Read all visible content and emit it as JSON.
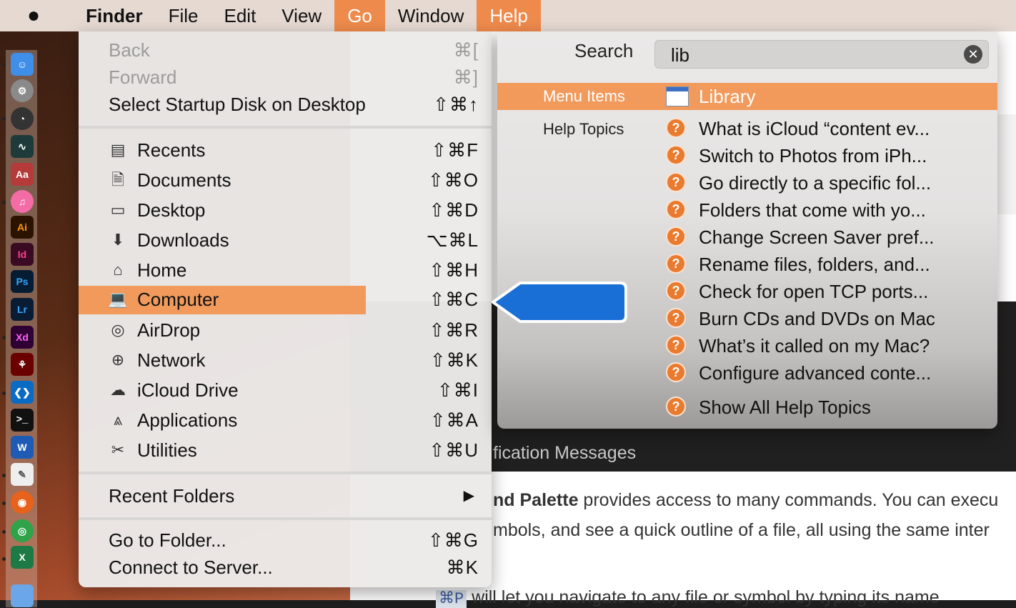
{
  "menubar": {
    "app_name": "Finder",
    "items": [
      "File",
      "Edit",
      "View",
      "Go",
      "Window",
      "Help"
    ],
    "active": [
      "Go",
      "Help"
    ]
  },
  "go_menu": {
    "top_items": [
      {
        "label": "Back",
        "shortcut": "⌘[",
        "disabled": true
      },
      {
        "label": "Forward",
        "shortcut": "⌘]",
        "disabled": true
      },
      {
        "label": "Select Startup Disk on Desktop",
        "shortcut": "⇧⌘↑",
        "disabled": false
      }
    ],
    "places": [
      {
        "label": "Recents",
        "shortcut": "⇧⌘F",
        "icon": "recents-icon"
      },
      {
        "label": "Documents",
        "shortcut": "⇧⌘O",
        "icon": "documents-icon"
      },
      {
        "label": "Desktop",
        "shortcut": "⇧⌘D",
        "icon": "desktop-icon"
      },
      {
        "label": "Downloads",
        "shortcut": "⌥⌘L",
        "icon": "downloads-icon"
      },
      {
        "label": "Home",
        "shortcut": "⇧⌘H",
        "icon": "home-icon"
      },
      {
        "label": "Computer",
        "shortcut": "⇧⌘C",
        "icon": "computer-icon",
        "selected": true
      },
      {
        "label": "AirDrop",
        "shortcut": "⇧⌘R",
        "icon": "airdrop-icon"
      },
      {
        "label": "Network",
        "shortcut": "⇧⌘K",
        "icon": "network-icon"
      },
      {
        "label": "iCloud Drive",
        "shortcut": "⇧⌘I",
        "icon": "icloud-icon"
      },
      {
        "label": "Applications",
        "shortcut": "⇧⌘A",
        "icon": "applications-icon"
      },
      {
        "label": "Utilities",
        "shortcut": "⇧⌘U",
        "icon": "utilities-icon"
      }
    ],
    "recent_folders": "Recent Folders",
    "bottom_items": [
      {
        "label": "Go to Folder...",
        "shortcut": "⇧⌘G"
      },
      {
        "label": "Connect to Server...",
        "shortcut": "⌘K"
      }
    ]
  },
  "help_menu": {
    "search_label": "Search",
    "search_value": "lib",
    "menu_items_label": "Menu Items",
    "menu_item_result": "Library",
    "help_topics_label": "Help Topics",
    "topics": [
      "What is iCloud “content ev...",
      "Switch to Photos from iPh...",
      "Go directly to a specific fol...",
      "Folders that come with yo...",
      "Change Screen Saver pref...",
      "Rename files, folders, and...",
      "Check for open TCP ports...",
      "Burn CDs and DVDs on Mac",
      "What’s it called on my Mac?",
      "Configure advanced conte..."
    ],
    "show_all": "Show All Help Topics"
  },
  "background": {
    "dark_text": "fication Messages",
    "line1_bold": "nd Palette",
    "line1_rest": " provides access to many commands. You can execu",
    "line2": "mbols, and see a quick outline of a file, all using the same inter",
    "line3_code": "⌘P",
    "line3_rest": " will let you navigate to any file or symbol by typing its name"
  },
  "colors": {
    "menubar": "#e5d9d2",
    "highlight": "#f19a5c",
    "callout": "#1a6fd6"
  }
}
